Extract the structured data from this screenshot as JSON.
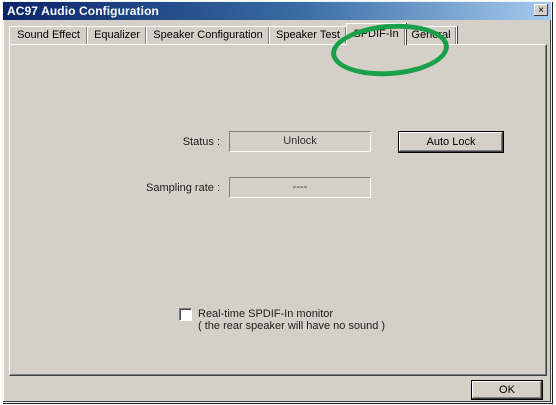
{
  "window": {
    "title": "AC97 Audio Configuration",
    "close_glyph": "×"
  },
  "tabs": [
    {
      "label": "Sound Effect",
      "active": false
    },
    {
      "label": "Equalizer",
      "active": false
    },
    {
      "label": "Speaker Configuration",
      "active": false
    },
    {
      "label": "Speaker Test",
      "active": false
    },
    {
      "label": "SPDIF-In",
      "active": true
    },
    {
      "label": "General",
      "active": false
    }
  ],
  "spdif_in": {
    "status_label": "Status :",
    "status_value": "Unlock",
    "auto_lock_button": "Auto Lock",
    "sampling_rate_label": "Sampling rate :",
    "sampling_rate_value": "----",
    "monitor_checkbox": {
      "checked": false,
      "label_line1": "Real-time SPDIF-In monitor",
      "label_line2": "( the rear speaker will have no sound )"
    }
  },
  "footer": {
    "ok_button": "OK"
  },
  "colors": {
    "annotation": "#1aa04a",
    "titlebar_start": "#0a246a",
    "face": "#d4d0c8"
  },
  "icons": {
    "close": "close-icon"
  }
}
